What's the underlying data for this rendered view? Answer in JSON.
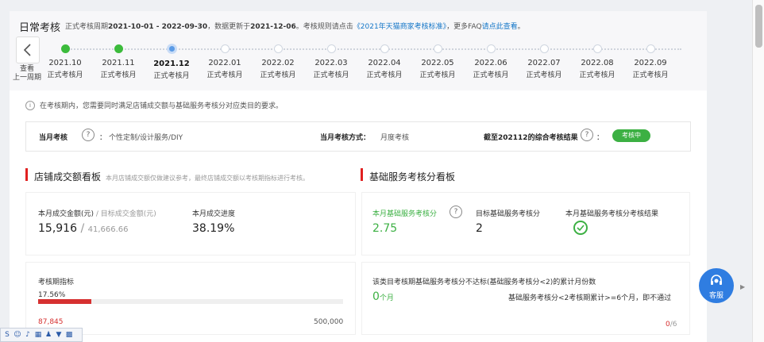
{
  "header": {
    "title": "日常考核",
    "period_prefix": "正式考核周期",
    "period_range": "2021-10-01 - 2022-09-30",
    "update_prefix": "，数据更新于",
    "update_date": "2021-12-06",
    "rule_prefix": "。考核规则请点击",
    "rule_link": "《2021年天猫商家考核标准》",
    "faq_prefix": "，更多FAQ",
    "faq_link": "请点此查看",
    "faq_suffix": "。"
  },
  "back": {
    "label_1": "查看",
    "label_2": "上一周期"
  },
  "timeline": [
    {
      "month": "2021.10",
      "sub": "正式考核月",
      "state": "done"
    },
    {
      "month": "2021.11",
      "sub": "正式考核月",
      "state": "done"
    },
    {
      "month": "2021.12",
      "sub": "正式考核月",
      "state": "current"
    },
    {
      "month": "2022.01",
      "sub": "正式考核月",
      "state": "future"
    },
    {
      "month": "2022.02",
      "sub": "正式考核月",
      "state": "future"
    },
    {
      "month": "2022.03",
      "sub": "正式考核月",
      "state": "future"
    },
    {
      "month": "2022.04",
      "sub": "正式考核月",
      "state": "future"
    },
    {
      "month": "2022.05",
      "sub": "正式考核月",
      "state": "future"
    },
    {
      "month": "2022.06",
      "sub": "正式考核月",
      "state": "future"
    },
    {
      "month": "2022.07",
      "sub": "正式考核月",
      "state": "future"
    },
    {
      "month": "2022.08",
      "sub": "正式考核月",
      "state": "future"
    },
    {
      "month": "2022.09",
      "sub": "正式考核月",
      "state": "future"
    }
  ],
  "notice": "在考核期内，您需要同时满足店铺成交额与基础服务考核分对应类目的要求。",
  "assessment": {
    "category_label": "当月考核",
    "category_value": "个性定制/设计服务/DIY",
    "mode_label": "当月考核方式：",
    "mode_value": "月度考核",
    "result_label": "截至202112的综合考核结果",
    "result_colon": "：",
    "status": "考核中"
  },
  "sales": {
    "title": "店铺成交额看板",
    "note": "本月店铺成交额仅做建议参考，最终店铺成交额以考核期指标进行考核。",
    "amount_label": "本月成交金额(元)",
    "target_label": " / 目标成交金额(元)",
    "amount": "15,916",
    "slash": " / ",
    "target": "41,666.66",
    "progress_label": "本月成交进度",
    "progress": "38.19%",
    "period_label": "考核期指标",
    "period_pct": "17.56%",
    "period_fill": 17.56,
    "period_actual": "87,845",
    "period_target": "500,000"
  },
  "service": {
    "title": "基础服务考核分看板",
    "score_label": "本月基础服务考核分",
    "score": "2.75",
    "target_label": "目标基础服务考核分",
    "target": "2",
    "result_label": "本月基础服务考核分考核结果",
    "fail_title": "该类目考核期基础服务考核分不达标(基础服务考核分<2)的累计月份数",
    "fail_count": "0",
    "fail_unit": "个月",
    "fail_rule": "基础服务考核分<2考核期累计>=6个月，即不通过",
    "fail_ratio_num": "0",
    "fail_ratio_den": "/6"
  },
  "chat": {
    "label": "客服"
  },
  "colors": {
    "accent": "#e02020",
    "green": "#3cb043",
    "blue": "#2f7de1",
    "progress": "#d63030"
  }
}
